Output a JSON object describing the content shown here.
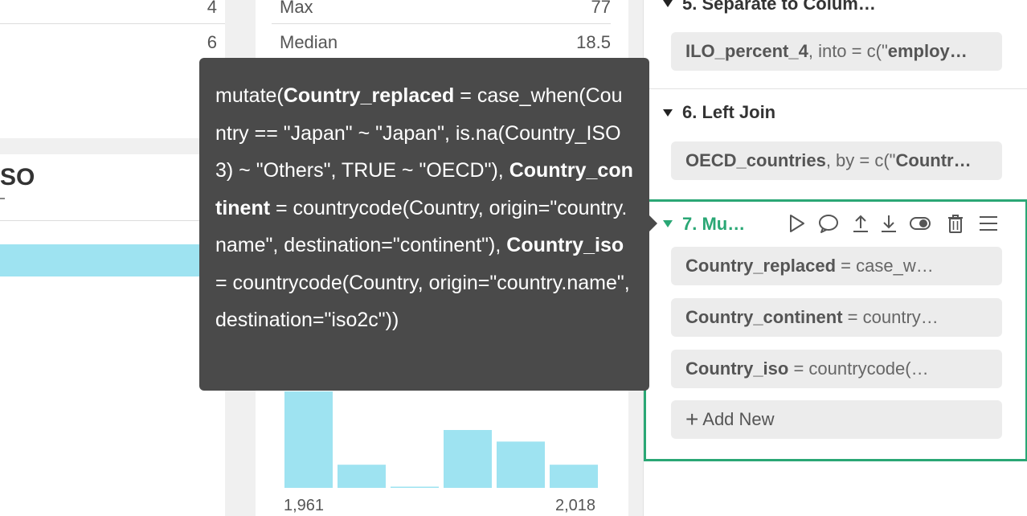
{
  "left": {
    "row1_value": "4",
    "row2_value": "6",
    "column_title": "SO"
  },
  "stats": {
    "rows": [
      {
        "label": "Max",
        "value": "77"
      },
      {
        "label": "Median",
        "value": "18.5"
      }
    ]
  },
  "chart_data": {
    "type": "bar",
    "x_tick_labels": [
      "1,961",
      "2,018"
    ],
    "values": [
      100,
      24,
      1,
      60,
      48,
      24
    ],
    "ylim": [
      0,
      100
    ]
  },
  "tooltip": {
    "segments": [
      {
        "text": "mutate(",
        "bold": false
      },
      {
        "text": "Country_replaced",
        "bold": true
      },
      {
        "text": " = case_when(Country == \"Japan\" ~ \"Japan\", is.na(Country_ISO3) ~ \"Others\", TRUE ~ \"OECD\"), ",
        "bold": false
      },
      {
        "text": "Country_continent",
        "bold": true
      },
      {
        "text": " = countrycode(Country, origin=\"country.name\", destination=\"continent\"), ",
        "bold": false
      },
      {
        "text": "Country_iso",
        "bold": true
      },
      {
        "text": " = countrycode(Country, origin=\"country.name\", destination=\"iso2c\"))",
        "bold": false
      }
    ]
  },
  "steps": {
    "step5": {
      "title": "5. Separate to Colum…",
      "pill_bold": "ILO_percent_4",
      "pill_rest": ", into = c(\"",
      "pill_bold2": "employ…"
    },
    "step6": {
      "title": "6. Left Join",
      "pill_bold": "OECD_countries",
      "pill_rest": ", by = c(\"",
      "pill_bold2": "Countr…"
    },
    "step7": {
      "title": "7. Mu…",
      "items": [
        {
          "name": "Country_replaced",
          "rest": " = case_w…"
        },
        {
          "name": "Country_continent",
          "rest": " = country…"
        },
        {
          "name": "Country_iso",
          "rest": " = countrycode(…"
        }
      ],
      "add_new": "Add New"
    }
  },
  "colors": {
    "accent": "#2aa775",
    "bar": "#9ee3f1",
    "tooltip_bg": "#4a4a4a"
  }
}
